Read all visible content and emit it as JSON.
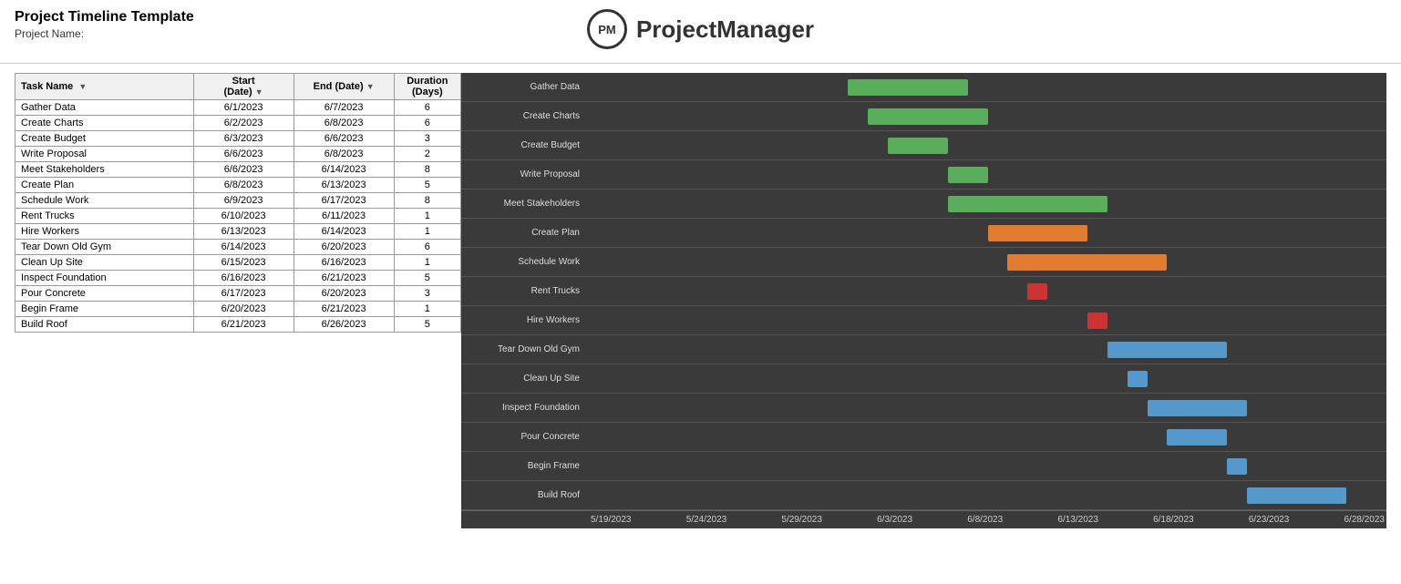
{
  "title": "Project Timeline Template",
  "project_name_label": "Project Name:",
  "logo": {
    "circle_text": "PM",
    "name": "ProjectManager"
  },
  "table": {
    "headers": [
      "Task Name",
      "Start (Date)",
      "End  (Date)",
      "Duration (Days)"
    ],
    "rows": [
      {
        "task": "Gather Data",
        "start": "6/1/2023",
        "end": "6/7/2023",
        "duration": 6
      },
      {
        "task": "Create Charts",
        "start": "6/2/2023",
        "end": "6/8/2023",
        "duration": 6
      },
      {
        "task": "Create Budget",
        "start": "6/3/2023",
        "end": "6/6/2023",
        "duration": 3
      },
      {
        "task": "Write Proposal",
        "start": "6/6/2023",
        "end": "6/8/2023",
        "duration": 2
      },
      {
        "task": "Meet Stakeholders",
        "start": "6/6/2023",
        "end": "6/14/2023",
        "duration": 8
      },
      {
        "task": "Create Plan",
        "start": "6/8/2023",
        "end": "6/13/2023",
        "duration": 5
      },
      {
        "task": "Schedule Work",
        "start": "6/9/2023",
        "end": "6/17/2023",
        "duration": 8
      },
      {
        "task": "Rent Trucks",
        "start": "6/10/2023",
        "end": "6/11/2023",
        "duration": 1
      },
      {
        "task": "Hire Workers",
        "start": "6/13/2023",
        "end": "6/14/2023",
        "duration": 1
      },
      {
        "task": "Tear Down Old Gym",
        "start": "6/14/2023",
        "end": "6/20/2023",
        "duration": 6
      },
      {
        "task": "Clean Up Site",
        "start": "6/15/2023",
        "end": "6/16/2023",
        "duration": 1
      },
      {
        "task": "Inspect Foundation",
        "start": "6/16/2023",
        "end": "6/21/2023",
        "duration": 5
      },
      {
        "task": "Pour Concrete",
        "start": "6/17/2023",
        "end": "6/20/2023",
        "duration": 3
      },
      {
        "task": "Begin Frame",
        "start": "6/20/2023",
        "end": "6/21/2023",
        "duration": 1
      },
      {
        "task": "Build Roof",
        "start": "6/21/2023",
        "end": "6/26/2023",
        "duration": 5
      }
    ]
  },
  "gantt": {
    "start_date": "5/19/2023",
    "end_date": "6/28/2023",
    "date_labels": [
      "5/19/2023",
      "5/24/2023",
      "5/29/2023",
      "6/3/2023",
      "6/8/2023",
      "6/13/2023",
      "6/18/2023",
      "6/23/2023",
      "6/28/2023"
    ],
    "bars": [
      {
        "task": "Gather Data",
        "start_offset_pct": 55.6,
        "width_pct": 15.0,
        "color": "#5aad5a"
      },
      {
        "task": "Create Charts",
        "start_offset_pct": 58.3,
        "width_pct": 15.0,
        "color": "#5aad5a"
      },
      {
        "task": "Create Budget",
        "start_offset_pct": 61.1,
        "width_pct": 7.5,
        "color": "#5aad5a"
      },
      {
        "task": "Write Proposal",
        "start_offset_pct": 69.4,
        "width_pct": 5.0,
        "color": "#5aad5a"
      },
      {
        "task": "Meet Stakeholders",
        "start_offset_pct": 69.4,
        "width_pct": 20.0,
        "color": "#5aad5a"
      },
      {
        "task": "Create Plan",
        "start_offset_pct": 75.0,
        "width_pct": 12.5,
        "color": "#e07b30"
      },
      {
        "task": "Schedule Work",
        "start_offset_pct": 77.8,
        "width_pct": 20.0,
        "color": "#e07b30"
      },
      {
        "task": "Rent Trucks",
        "start_offset_pct": 80.6,
        "width_pct": 3.5,
        "color": "#cc3333"
      },
      {
        "task": "Hire Workers",
        "start_offset_pct": 86.1,
        "width_pct": 3.5,
        "color": "#cc3333"
      },
      {
        "task": "Tear Down Old Gym",
        "start_offset_pct": 88.9,
        "width_pct": 15.0,
        "color": "#5599cc"
      },
      {
        "task": "Clean Up Site",
        "start_offset_pct": 91.7,
        "width_pct": 3.5,
        "color": "#5599cc"
      },
      {
        "task": "Inspect Foundation",
        "start_offset_pct": 94.4,
        "width_pct": 12.5,
        "color": "#5599cc"
      },
      {
        "task": "Pour Concrete",
        "start_offset_pct": 97.2,
        "width_pct": 7.5,
        "color": "#5599cc"
      },
      {
        "task": "Begin Frame",
        "start_offset_pct": 105.6,
        "width_pct": 3.5,
        "color": "#5599cc"
      },
      {
        "task": "Build Roof",
        "start_offset_pct": 108.3,
        "width_pct": 12.5,
        "color": "#5599cc"
      }
    ]
  }
}
